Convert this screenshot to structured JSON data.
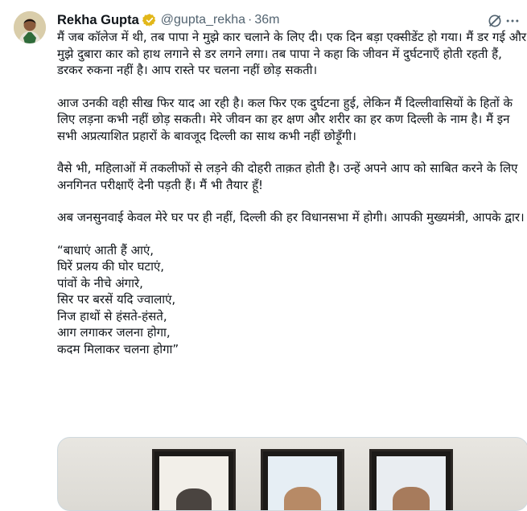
{
  "tweet": {
    "author_name": "Rekha Gupta",
    "handle": "@gupta_rekha",
    "separator": "·",
    "timestamp": "36m",
    "paragraphs": [
      "मैं जब कॉलेज में थी, तब पापा ने मुझे कार चलाने के लिए दी। एक दिन बड़ा एक्सीडेंट हो गया। मैं डर गई और मुझे दुबारा कार को हाथ लगाने से डर लगने लगा। तब पापा ने कहा कि जीवन में दुर्घटनाएँ होती रहती हैं, डरकर रुकना नहीं है। आप रास्ते पर चलना नहीं छोड़ सकती।",
      "आज उनकी वही सीख फिर याद आ रही है। कल फिर एक दुर्घटना हुई, लेकिन मैं दिल्लीवासियों के हितों के लिए लड़ना कभी नहीं छोड़ सकती। मेरे जीवन का हर क्षण और शरीर का हर कण दिल्ली के नाम है। मैं इन सभी अप्रत्याशित प्रहारों के बावजूद दिल्ली का साथ कभी नहीं छोड़ूँगी।",
      "वैसे भी, महिलाओं में तकलीफों से लड़ने की दोहरी ताक़त होती है। उन्हें अपने आप को साबित करने के लिए अनगिनत परीक्षाएँ देनी पड़ती हैं। मैं भी तैयार हूँ!",
      "अब जनसुनवाई केवल मेरे घर पर ही नहीं, दिल्ली की हर विधानसभा में होगी। आपकी मुख्यमंत्री, आपके द्वार।"
    ],
    "poem": "“बाधाएं आती हैं आएं,\nघिरें प्रलय की घोर घटाएं,\nपांवों के नीचे अंगारे,\nसिर पर बरसें यदि ज्वालाएं,\nनिज हाथों से हंसते-हंसते,\nआग लगाकर जलना होगा,\nकदम मिलाकर चलना होगा”"
  },
  "icons": {
    "verified": "verified-badge-icon",
    "grok": "grok-icon",
    "more": "more-icon"
  },
  "colors": {
    "text": "#0f1419",
    "secondary": "#536471",
    "verified_gold": "#e2b719",
    "border": "#cfd9de"
  }
}
